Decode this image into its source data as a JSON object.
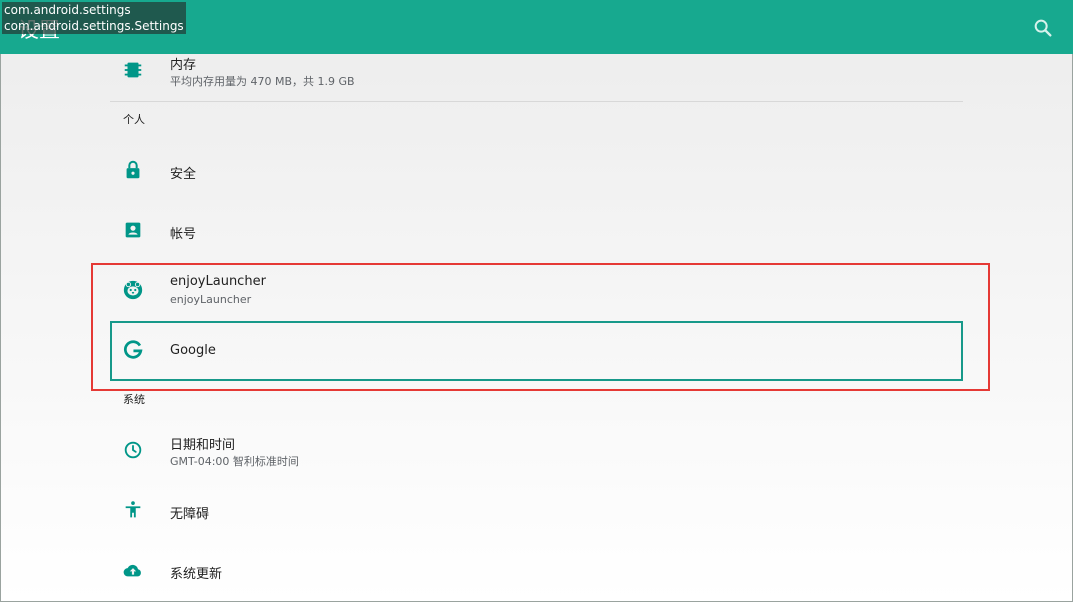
{
  "header": {
    "title": "设置",
    "icon": "search-icon"
  },
  "debug_overlay": {
    "package": "com.android.settings",
    "activity": "com.android.settings.Settings"
  },
  "rows": [
    {
      "id": "memory",
      "icon": "memory-chip-icon",
      "title": "内存",
      "summary": "平均内存用量为 470 MB，共 1.9 GB"
    },
    {
      "id": "security",
      "icon": "lock-icon",
      "title": "安全"
    },
    {
      "id": "accounts",
      "icon": "account-box-icon",
      "title": "帐号"
    },
    {
      "id": "enjoylauncher",
      "icon": "enjoylauncher-app-icon",
      "title": "enjoyLauncher",
      "summary": "enjoyLauncher"
    },
    {
      "id": "google",
      "icon": "google-g-icon",
      "title": "Google"
    },
    {
      "id": "datetime",
      "icon": "clock-icon",
      "title": "日期和时间",
      "summary": "GMT-04:00 智利标准时间"
    },
    {
      "id": "accessibility",
      "icon": "accessibility-icon",
      "title": "无障碍"
    },
    {
      "id": "system-update",
      "icon": "cloud-upload-icon",
      "title": "系统更新"
    }
  ],
  "sections": {
    "personal": "个人",
    "system": "系统"
  },
  "colors": {
    "appbar": "#17a98f",
    "icon_tint": "#009688",
    "highlight_outer": "#e53935",
    "highlight_inner": "#17998a"
  }
}
